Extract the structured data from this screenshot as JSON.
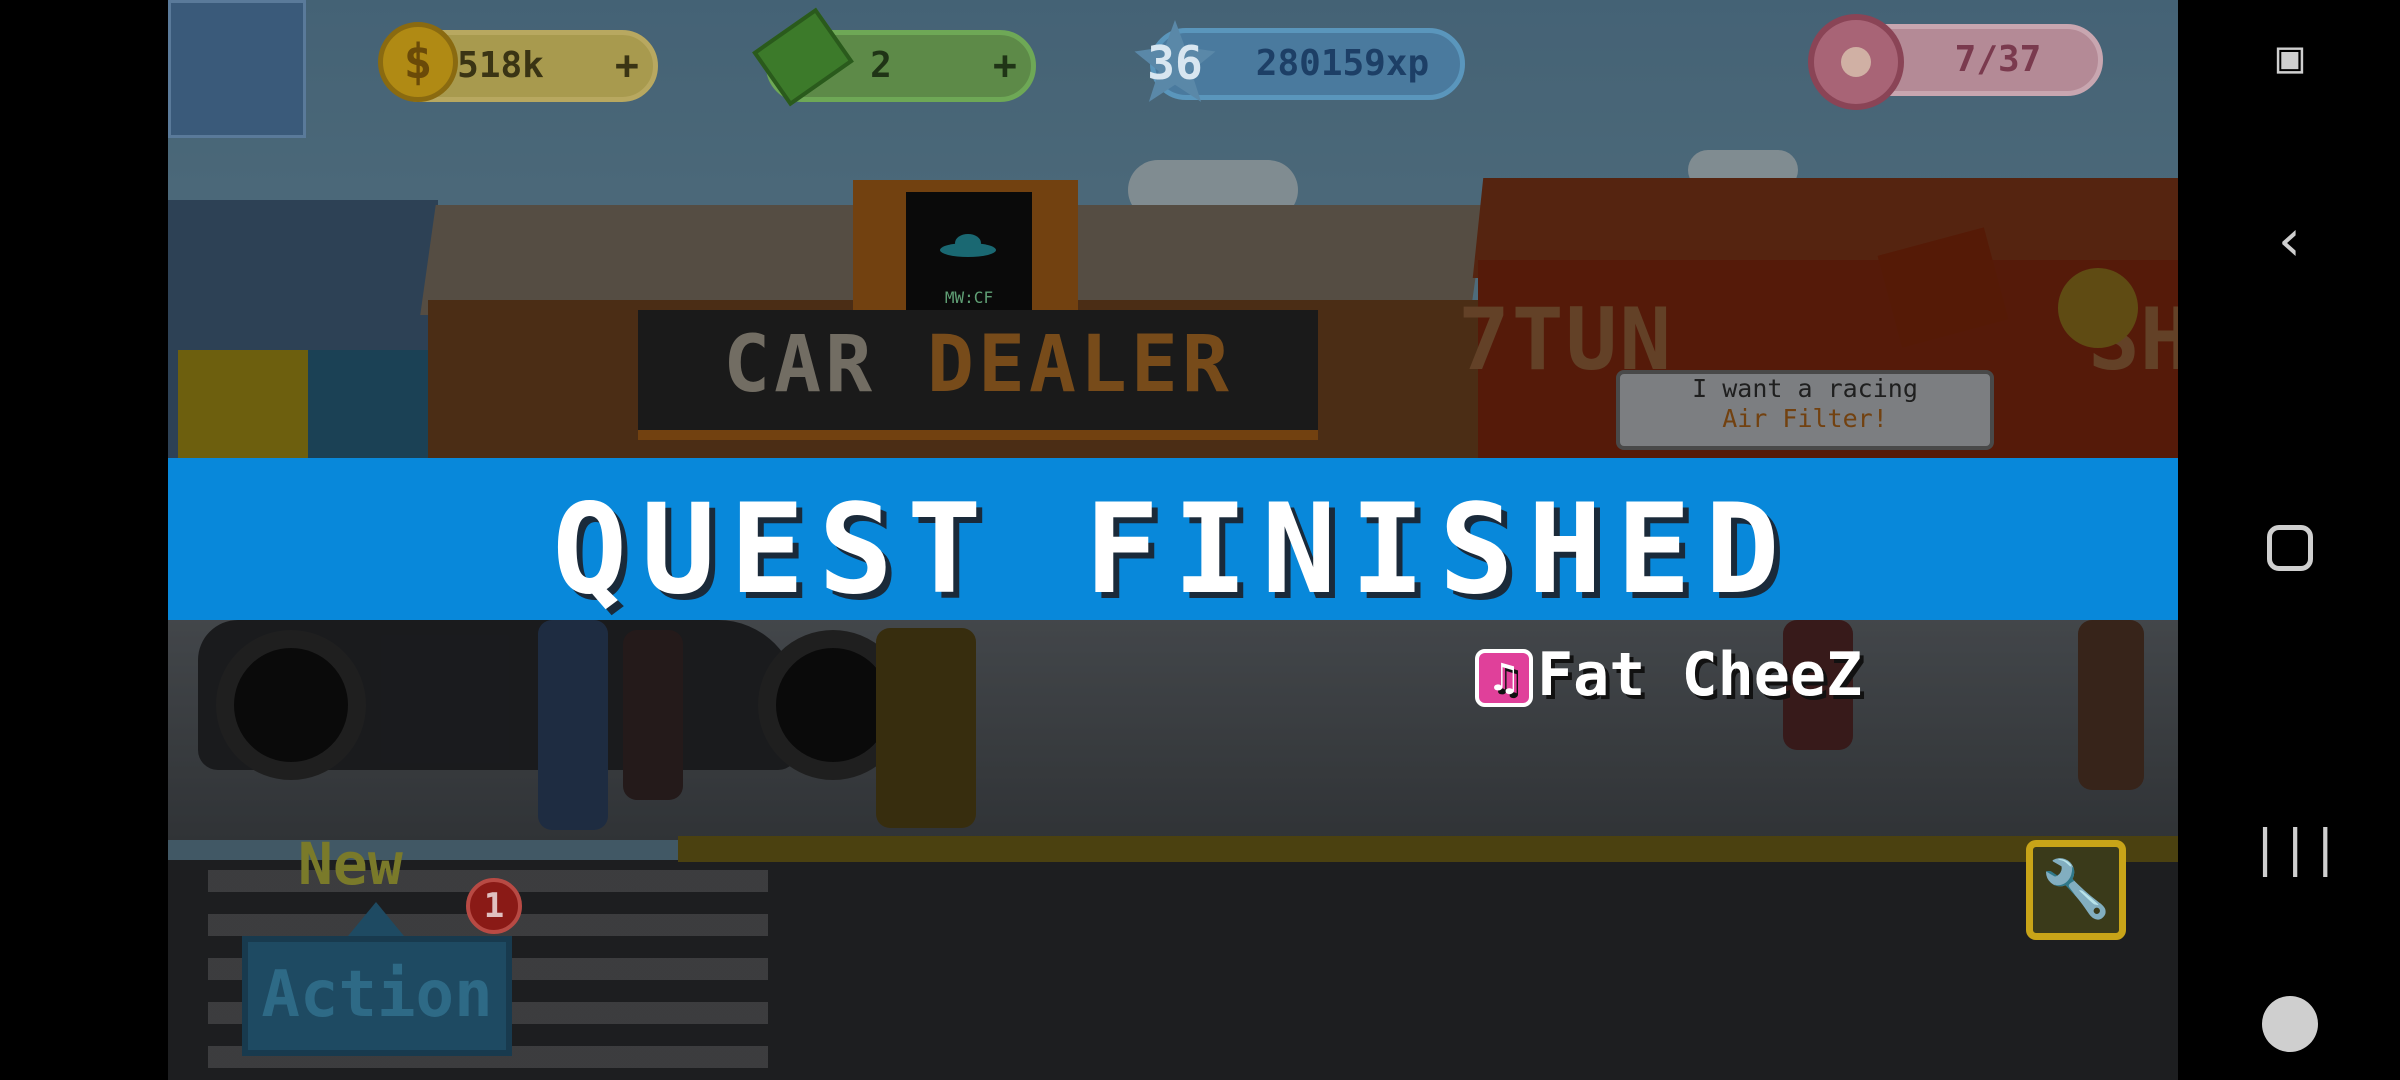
{
  "hud": {
    "coins": "518k",
    "coins_plus": "+",
    "cash": "2",
    "cash_plus": "+",
    "level": "36",
    "xp": "280159xp",
    "quest_progress": "7/37",
    "coin_symbol": "$"
  },
  "scene": {
    "dealer_sign_a": "CAR ",
    "dealer_sign_b": "DEALER",
    "screen_text": "MW:CF",
    "shop_sign_left": "7TUN",
    "shop_sign_right": "SHO",
    "speech_line1": "I want a racing",
    "speech_line2": "Air Filter!"
  },
  "banner": {
    "title": "QUEST FINISHED"
  },
  "track": {
    "name": "Fat CheeZ",
    "icon": "music-note-icon"
  },
  "action": {
    "new_label": "New",
    "badge_count": "1",
    "button_label": "Action"
  },
  "colors": {
    "banner": "#0888da",
    "badge": "#8a1a16",
    "wrench_border": "#c8a418"
  }
}
